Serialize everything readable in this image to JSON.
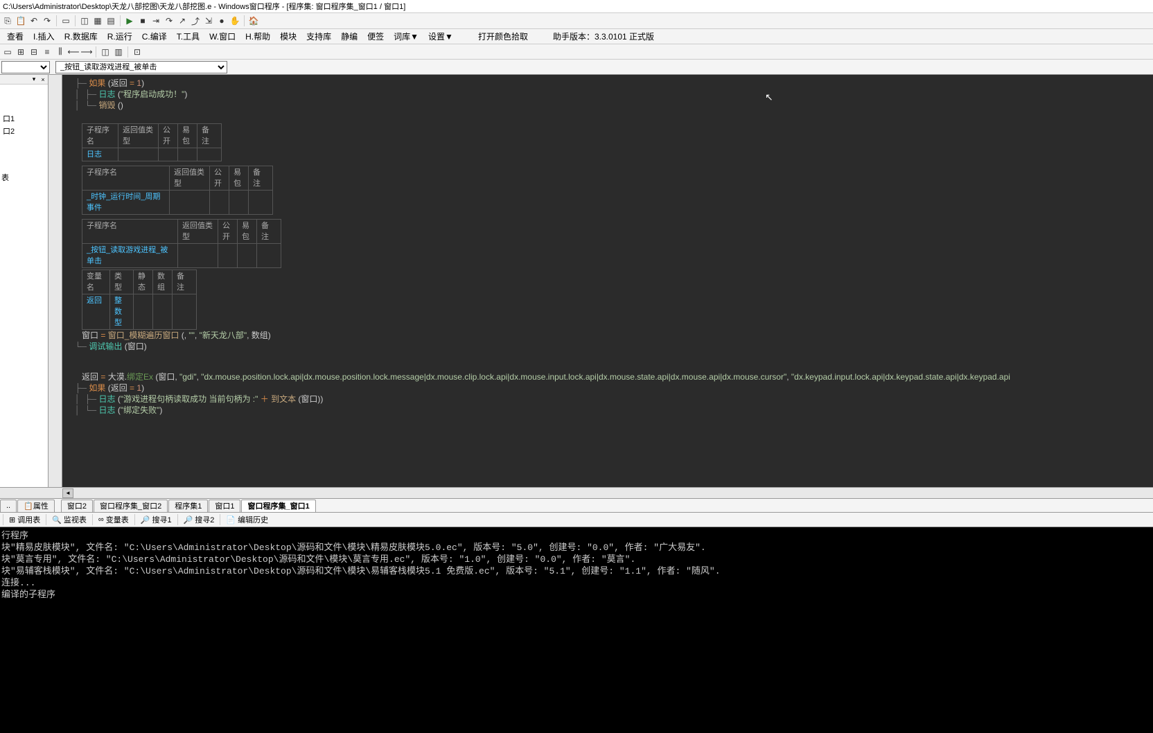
{
  "title": "C:\\Users\\Administrator\\Desktop\\天龙八部挖图\\天龙八部挖图.e - Windows窗口程序 - [程序集: 窗口程序集_窗口1 / 窗口1]",
  "menu": [
    "查看",
    "I.插入",
    "R.数据库",
    "R.运行",
    "C.编译",
    "T.工具",
    "W.窗口",
    "H.帮助",
    "模块",
    "支持库",
    "静编",
    "便签",
    "词库▼",
    "设置▼",
    "打开颜色拾取",
    "助手版本：3.3.0101 正式版"
  ],
  "combo1": "",
  "combo2": "_按钮_读取游戏进程_被单击",
  "side": {
    "items": [
      "口1",
      "口2"
    ],
    "label": "表"
  },
  "code": {
    "l1a": "如果",
    "l1b": " (返回 ",
    "l1c": "= ",
    "l1d": "1",
    "l1e": ")",
    "l2a": "日志",
    "l2b": " (",
    "l2c": "\"程序启动成功！\"",
    "l2d": ")",
    "l3a": "销毁",
    "l3b": " ()",
    "tbl1h": [
      "子程序名",
      "返回值类型",
      "公开",
      "易包",
      "备 注"
    ],
    "tbl1r": "日志",
    "tbl2h": [
      "子程序名",
      "返回值类型",
      "公开",
      "易包",
      "备 注"
    ],
    "tbl2r": "_时钟_运行时间_周期事件",
    "tbl3h": [
      "子程序名",
      "返回值类型",
      "公开",
      "易包",
      "备 注"
    ],
    "tbl3r": "_按钮_读取游戏进程_被单击",
    "tbl4h": [
      "变量名",
      "类 型",
      "静态",
      "数组",
      "备 注"
    ],
    "tbl4r1": "返回",
    "tbl4r2": "整数型",
    "l4a": "窗口 ",
    "l4b": "= ",
    "l4c": "窗口_模糊遍历窗口",
    "l4d": " (, ",
    "l4e": "\"\"",
    "l4f": ", ",
    "l4g": "\"新天龙八部\"",
    "l4h": ", 数组)",
    "l5a": "调试输出",
    "l5b": " (窗口)",
    "l6a": "返回 ",
    "l6b": "= ",
    "l6c": "大漠.",
    "l6d": "绑定Ex",
    "l6e": " (窗口, ",
    "l6f": "\"gdi\"",
    "l6g": ", ",
    "l6h": "\"dx.mouse.position.lock.api|dx.mouse.position.lock.message|dx.mouse.clip.lock.api|dx.mouse.input.lock.api|dx.mouse.state.api|dx.mouse.api|dx.mouse.cursor\"",
    "l6i": ", ",
    "l6j": "\"dx.keypad.input.lock.api|dx.keypad.state.api|dx.keypad.api",
    "l7a": "如果",
    "l7b": " (返回 ",
    "l7c": "= ",
    "l7d": "1",
    "l7e": ")",
    "l8a": "日志",
    "l8b": " (",
    "l8c": "\"游戏进程句柄读取成功 当前句柄为 :\"",
    "l8d": " ＋ ",
    "l8e": "到文本",
    "l8f": " (窗口))",
    "l9a": "日志",
    "l9b": " (",
    "l9c": "\"绑定失败\"",
    "l9d": ")"
  },
  "tabs": [
    "窗口2",
    "窗口程序集_窗口2",
    "程序集1",
    "窗口1",
    "窗口程序集_窗口1"
  ],
  "lefttabs": [
    "..",
    "属性"
  ],
  "btools": [
    "调用表",
    "监视表",
    "变量表",
    "搜寻1",
    "搜寻2",
    "编辑历史"
  ],
  "console": "行程序\n块\"精易皮肤模块\", 文件名: \"C:\\Users\\Administrator\\Desktop\\源码和文件\\模块\\精易皮肤模块5.0.ec\", 版本号: \"5.0\", 创建号: \"0.0\", 作者: \"广大易友\".\n块\"莫言专用\", 文件名: \"C:\\Users\\Administrator\\Desktop\\源码和文件\\模块\\莫言专用.ec\", 版本号: \"1.0\", 创建号: \"0.0\", 作者: \"莫言\".\n块\"易辅客栈模块\", 文件名: \"C:\\Users\\Administrator\\Desktop\\源码和文件\\模块\\易辅客栈模块5.1 免费版.ec\", 版本号: \"5.1\", 创建号: \"1.1\", 作者: \"随风\".\n连接...\n编译的子程序"
}
